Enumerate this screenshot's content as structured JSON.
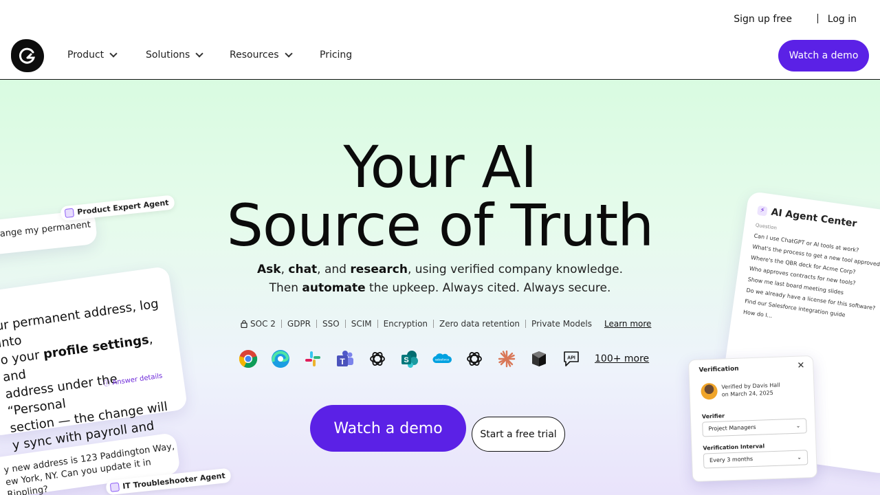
{
  "topbar": {
    "signup": "Sign up free",
    "login": "Log in"
  },
  "nav": {
    "items": [
      {
        "label": "Product",
        "dropdown": true
      },
      {
        "label": "Solutions",
        "dropdown": true
      },
      {
        "label": "Resources",
        "dropdown": true
      },
      {
        "label": "Pricing",
        "dropdown": false
      }
    ],
    "cta": "Watch a demo"
  },
  "hero": {
    "title_line1": "Your AI",
    "title_line2": "Source of Truth",
    "sub1": [
      {
        "t": "Ask",
        "b": true
      },
      {
        "t": ", ",
        "b": false
      },
      {
        "t": "chat",
        "b": true
      },
      {
        "t": ", and ",
        "b": false
      },
      {
        "t": "research",
        "b": true
      },
      {
        "t": ", using verified company knowledge.",
        "b": false
      }
    ],
    "sub2": [
      {
        "t": "Then ",
        "b": false
      },
      {
        "t": "automate",
        "b": true
      },
      {
        "t": " the upkeep. Always cited. Always secure.",
        "b": false
      }
    ],
    "badges": [
      "SOC 2",
      "GDPR",
      "SSO",
      "SCIM",
      "Encryption",
      "Zero data retention",
      "Private Models"
    ],
    "learn_more": "Learn more",
    "integrations": [
      "chrome-icon",
      "edge-icon",
      "slack-icon",
      "teams-icon",
      "openai-icon",
      "sharepoint-icon",
      "salesforce-icon",
      "openai-icon",
      "claude-icon",
      "zendesk-icon",
      "api-icon"
    ],
    "more": "100+ more",
    "cta_primary": "Watch a demo",
    "cta_secondary": "Start a free trial"
  },
  "left": {
    "tag1": "Product Expert Agent",
    "bubble1": "ange my permanent",
    "answer_lines": [
      [
        {
          "t": "ur permanent address, log into",
          "b": false
        }
      ],
      [
        {
          "t": "o your ",
          "b": false
        },
        {
          "t": "profile settings",
          "b": true
        },
        {
          "t": ", and",
          "b": false
        }
      ],
      [
        {
          "t": "address under the “Personal",
          "b": false
        }
      ],
      [
        {
          "t": "section — the change will",
          "b": false
        }
      ],
      [
        {
          "t": "y sync with payroll and benefits.",
          "b": false
        }
      ]
    ],
    "answer_details": "Answer details",
    "bubble2_line1": "y new address is 123 Paddington Way,",
    "bubble2_line2": "ew York, NY. Can you update it in Rippling?",
    "tag2": "IT Troubleshooter Agent"
  },
  "right": {
    "title": "AI Agent Center",
    "col": "Question",
    "rows": [
      "Can I use ChatGPT or AI tools at work?",
      "What's the process to get a new tool approved?",
      "Where's the QBR deck for Acme Corp?",
      "Who approves contracts for new tools?",
      "Show me last board meeting slides",
      "Do we already have a license for this software?",
      "Find our Salesforce integration guide",
      "How do I..."
    ],
    "verification": {
      "title": "Verification",
      "verified_by": "Verified by Davis Hall",
      "verified_on": "on March 24, 2025",
      "verifier_label": "Verifier",
      "verifier_value": "Project Managers",
      "interval_label": "Verification Interval",
      "interval_value": "Every 3 months"
    }
  },
  "colors": {
    "accent": "#5b21e6",
    "hero_top": "#d9fbe1",
    "hero_bottom": "#e9e3fb"
  }
}
